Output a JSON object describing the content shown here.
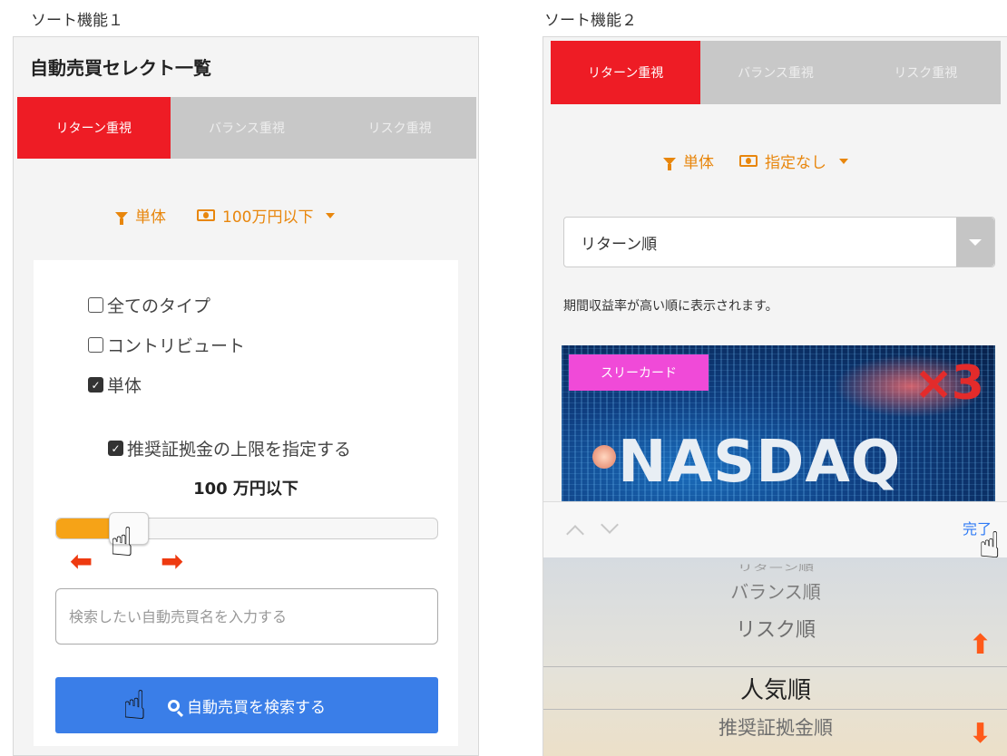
{
  "captions": {
    "left": "ソート機能１",
    "right": "ソート機能２"
  },
  "panel1": {
    "title": "自動売買セレクト一覧",
    "tabs": [
      {
        "label": "リターン重視",
        "active": true
      },
      {
        "label": "バランス重視",
        "active": false
      },
      {
        "label": "リスク重視",
        "active": false
      }
    ],
    "filter": {
      "type_label": "単体",
      "margin_label": "100万円以下",
      "icons": [
        "funnel-icon",
        "money-icon",
        "caret-down-icon"
      ]
    },
    "checkboxes": [
      {
        "label": "全てのタイプ",
        "checked": false
      },
      {
        "label": "コントリビュート",
        "checked": false
      },
      {
        "label": "単体",
        "checked": true
      }
    ],
    "limit_checkbox": {
      "label": "推奨証拠金の上限を指定する",
      "checked": true
    },
    "limit_value": "100 万円以下",
    "slider": {
      "level_percent": 19
    },
    "search": {
      "placeholder": "検索したい自動売買名を入力する",
      "value": ""
    },
    "search_button": {
      "label": "自動売買を検索する",
      "icon": "search-icon"
    }
  },
  "panel2": {
    "tabs": [
      {
        "label": "リターン重視",
        "active": true
      },
      {
        "label": "バランス重視",
        "active": false
      },
      {
        "label": "リスク重視",
        "active": false
      }
    ],
    "filter": {
      "type_label": "単体",
      "margin_label": "指定なし"
    },
    "sort_select": {
      "value": "リターン順"
    },
    "sort_description": "期間収益率が高い順に表示されます。",
    "banner": {
      "badge": "スリーカード",
      "multiplier": "×3",
      "title": "NASDAQ"
    },
    "toolbar": {
      "done_label": "完了"
    },
    "picker": {
      "options": [
        "リターン順",
        "バランス順",
        "リスク順",
        "人気順",
        "推奨証拠金順"
      ],
      "selected": "人気順"
    }
  },
  "colors": {
    "active_tab": "#ee1c25",
    "accent_orange": "#e8860c",
    "search_button": "#3a7ee8",
    "slider_fill": "#f6a317",
    "badge": "#f04ad8"
  }
}
